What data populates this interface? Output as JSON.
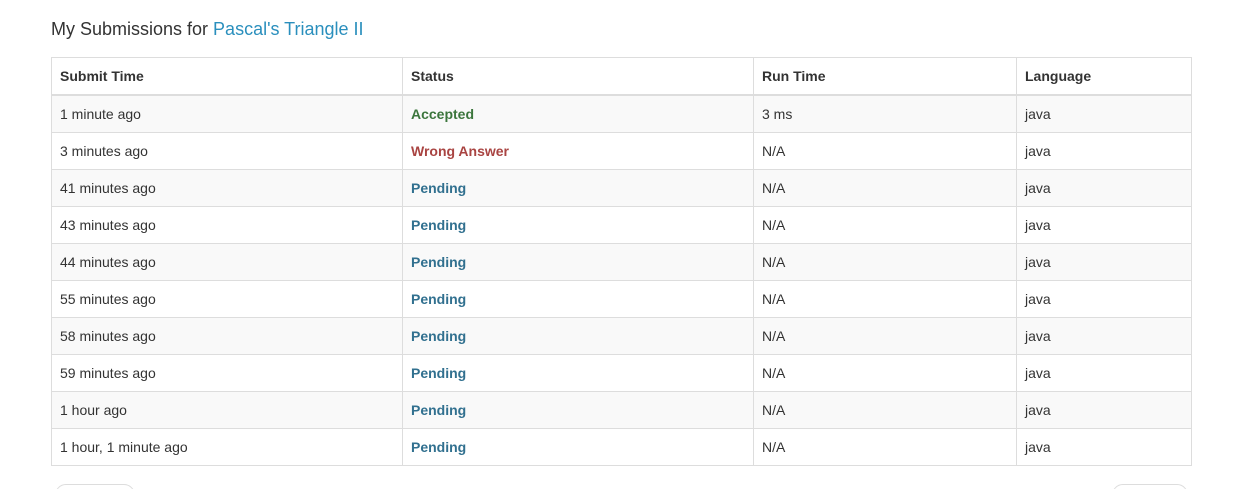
{
  "heading": {
    "prefix": "My Submissions for ",
    "problem_link": "Pascal's Triangle II"
  },
  "table": {
    "columns": [
      "Submit Time",
      "Status",
      "Run Time",
      "Language"
    ],
    "rows": [
      {
        "submit_time": "1 minute ago",
        "status": "Accepted",
        "run_time": "3 ms",
        "language": "java"
      },
      {
        "submit_time": "3 minutes ago",
        "status": "Wrong Answer",
        "run_time": "N/A",
        "language": "java"
      },
      {
        "submit_time": "41 minutes ago",
        "status": "Pending",
        "run_time": "N/A",
        "language": "java"
      },
      {
        "submit_time": "43 minutes ago",
        "status": "Pending",
        "run_time": "N/A",
        "language": "java"
      },
      {
        "submit_time": "44 minutes ago",
        "status": "Pending",
        "run_time": "N/A",
        "language": "java"
      },
      {
        "submit_time": "55 minutes ago",
        "status": "Pending",
        "run_time": "N/A",
        "language": "java"
      },
      {
        "submit_time": "58 minutes ago",
        "status": "Pending",
        "run_time": "N/A",
        "language": "java"
      },
      {
        "submit_time": "59 minutes ago",
        "status": "Pending",
        "run_time": "N/A",
        "language": "java"
      },
      {
        "submit_time": "1 hour ago",
        "status": "Pending",
        "run_time": "N/A",
        "language": "java"
      },
      {
        "submit_time": "1 hour, 1 minute ago",
        "status": "Pending",
        "run_time": "N/A",
        "language": "java"
      }
    ]
  },
  "colors": {
    "link": "#2a8fbd",
    "accepted": "#3c763d",
    "wrong_answer": "#a94442",
    "pending": "#31708f"
  }
}
